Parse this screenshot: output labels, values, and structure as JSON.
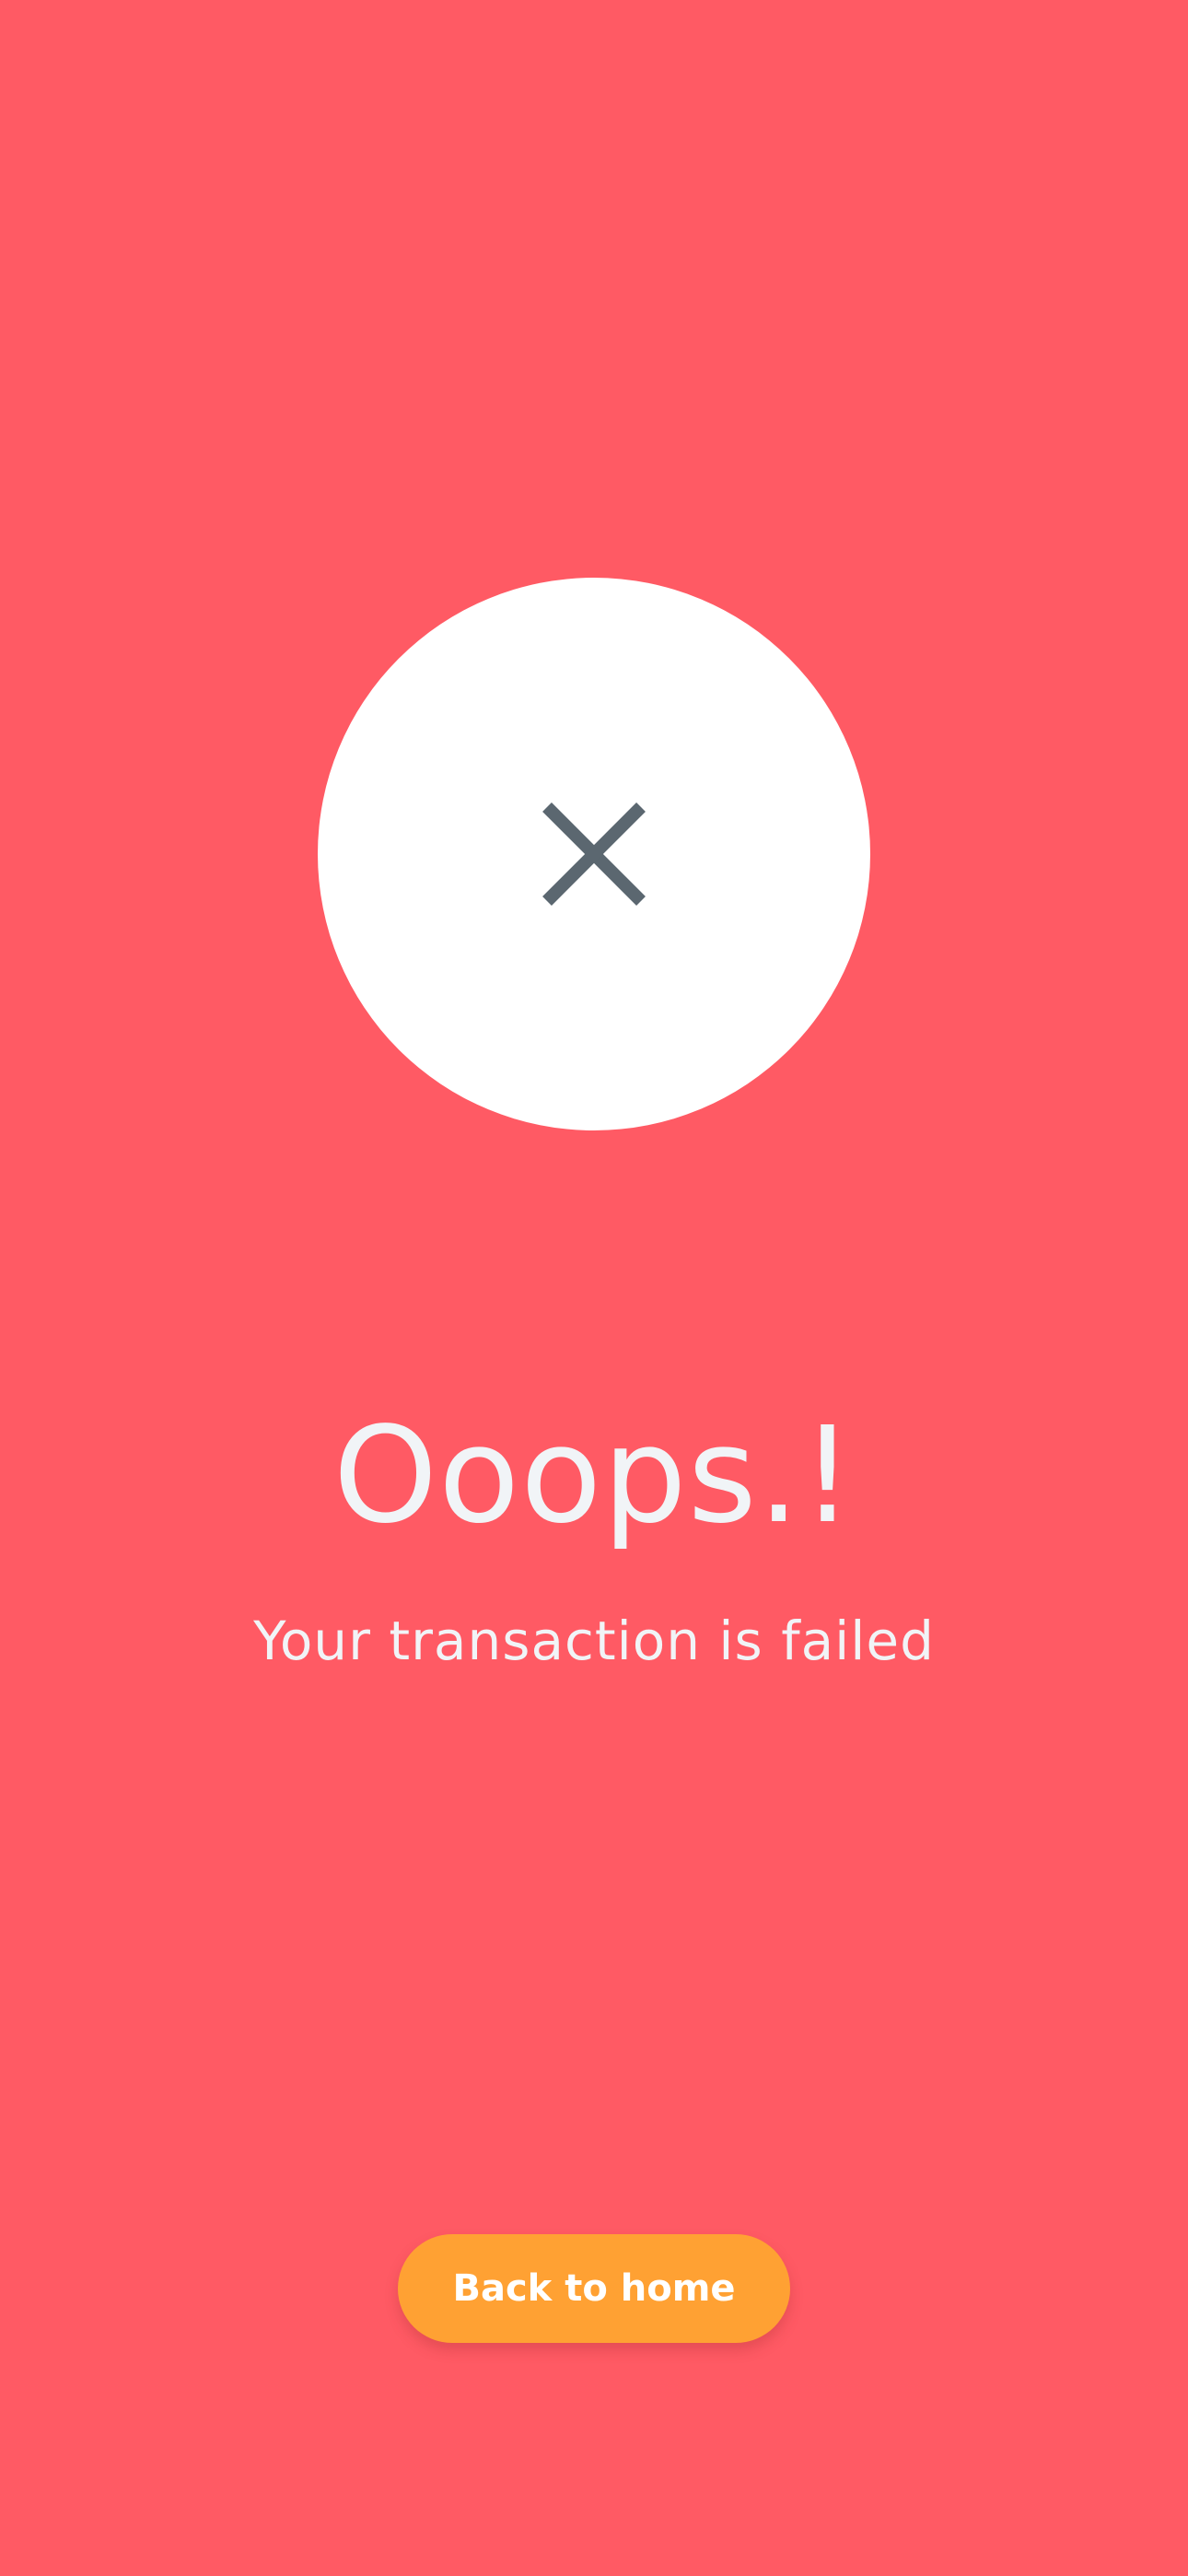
{
  "colors": {
    "background": "#FF5A64",
    "circle": "#FFFFFF",
    "icon": "#5B6770",
    "text": "#F1F4F7",
    "button": "#FFA133",
    "button_text": "#FFFFFF"
  },
  "icon": "close-icon",
  "result": {
    "title": "Ooops.!",
    "message": "Your transaction is failed"
  },
  "actions": {
    "back_home_label": "Back to home"
  }
}
